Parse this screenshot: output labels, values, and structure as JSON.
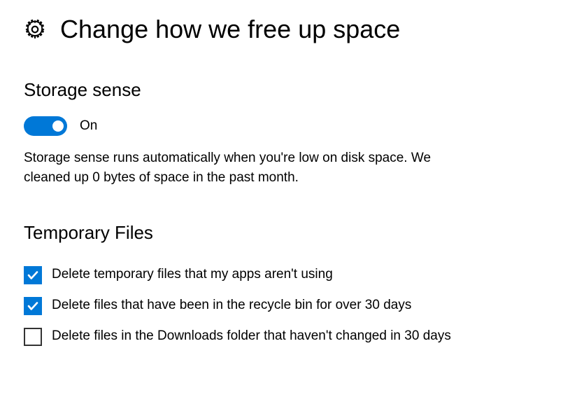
{
  "header": {
    "title": "Change how we free up space"
  },
  "storage_sense": {
    "heading": "Storage sense",
    "toggle_state_label": "On",
    "description": "Storage sense runs automatically when you're low on disk space. We cleaned up 0 bytes of space in the past month."
  },
  "temporary_files": {
    "heading": "Temporary Files",
    "options": [
      {
        "label": "Delete temporary files that my apps aren't using",
        "checked": true
      },
      {
        "label": "Delete files that have been in the recycle bin for over 30 days",
        "checked": true
      },
      {
        "label": "Delete files in the Downloads folder that haven't changed in 30 days",
        "checked": false
      }
    ]
  },
  "colors": {
    "accent": "#0078d7"
  }
}
